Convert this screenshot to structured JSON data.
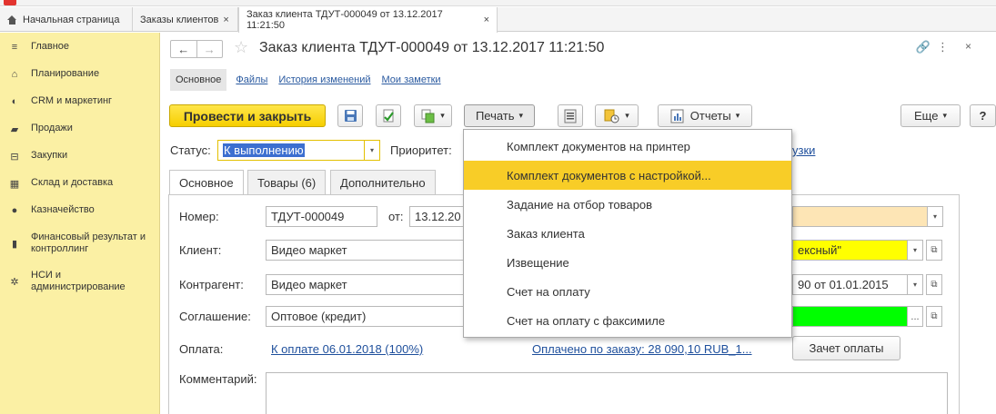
{
  "tabs": [
    {
      "label": "Начальная страница"
    },
    {
      "label": "Заказы клиентов",
      "close": "×"
    },
    {
      "label": "Заказ клиента ТДУТ-000049 от 13.12.2017 11:21:50",
      "close": "×"
    }
  ],
  "sidebar": {
    "items": [
      {
        "label": "Главное",
        "icon": "≡"
      },
      {
        "label": "Планирование",
        "icon": "⌂"
      },
      {
        "label": "CRM и маркетинг",
        "icon": "◐"
      },
      {
        "label": "Продажи",
        "icon": "▰"
      },
      {
        "label": "Закупки",
        "icon": "⊟"
      },
      {
        "label": "Склад и доставка",
        "icon": "▦"
      },
      {
        "label": "Казначейство",
        "icon": "●"
      },
      {
        "label": "Финансовый результат и контроллинг",
        "icon": "▮"
      },
      {
        "label": "НСИ и администрирование",
        "icon": "✲"
      }
    ]
  },
  "header": {
    "nav_back": "←",
    "nav_forward": "→",
    "star": "☆",
    "title": "Заказ клиента ТДУТ-000049 от 13.12.2017 11:21:50",
    "link_icon": "🔗",
    "more": "⋮",
    "close": "×"
  },
  "subtabs": [
    {
      "label": "Основное"
    },
    {
      "label": "Файлы"
    },
    {
      "label": "История изменений"
    },
    {
      "label": "Мои заметки"
    }
  ],
  "toolbar": {
    "post_close": "Провести и закрыть",
    "print": "Печать",
    "reports": "Отчеты",
    "more": "Еще",
    "help": "?",
    "caret": "▾"
  },
  "status": {
    "label": "Статус:",
    "value": "К выполнению",
    "priority_label": "Приоритет:",
    "hidden_link_tail": "узки"
  },
  "form_tabs": [
    {
      "label": "Основное"
    },
    {
      "label": "Товары (6)"
    },
    {
      "label": "Дополнительно"
    }
  ],
  "form": {
    "number_label": "Номер:",
    "number_value": "ТДУТ-000049",
    "from_label": "от:",
    "date_value": "13.12.20",
    "client_label": "Клиент:",
    "client_value": "Видео маркет",
    "client_right": "ексный\"",
    "counterparty_label": "Контрагент:",
    "counterparty_value": "Видео маркет",
    "contract_right": "90 от 01.01.2015",
    "agreement_label": "Соглашение:",
    "agreement_value": "Оптовое (кредит)",
    "agreement_btn": "...",
    "payment_label": "Оплата:",
    "payment_link": "К оплате 06.01.2018 (100%)",
    "paid_link": "Оплачено по заказу: 28 090,10 RUB_1...",
    "offset_btn": "Зачет оплаты",
    "comment_label": "Комментарий:"
  },
  "print_menu": {
    "items": [
      {
        "label": "Комплект документов на принтер"
      },
      {
        "label": "Комплект документов с настройкой..."
      },
      {
        "label": "Задание на отбор товаров"
      },
      {
        "label": "Заказ клиента"
      },
      {
        "label": "Извещение"
      },
      {
        "label": "Счет на оплату"
      },
      {
        "label": "Счет на оплату с факсимиле"
      }
    ],
    "highlighted_index": 1
  },
  "colors": {
    "sidebar_bg": "#fbf0a4",
    "primary_button": "#f6cf00",
    "menu_highlight": "#f8cd27",
    "client_field_highlight": "#ffff00",
    "agreement_field_highlight": "#00ff00",
    "number_field_highlight": "#fde5b5"
  }
}
